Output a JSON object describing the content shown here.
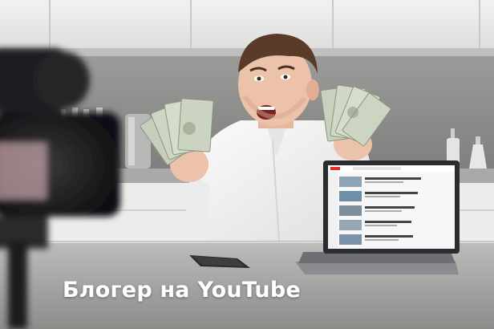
{
  "caption": {
    "text": "Блогер на YouTube"
  }
}
